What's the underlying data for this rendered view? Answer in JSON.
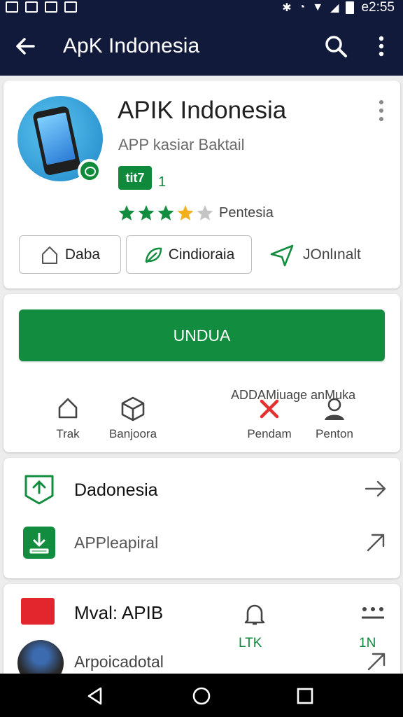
{
  "status_bar": {
    "time": "e2:55"
  },
  "app_bar": {
    "title": "ApK Indonesia"
  },
  "app": {
    "name": "APIK Indonesia",
    "developer": "APP kasiar Baktail",
    "rating_badge": "tit7",
    "rating_count": "1",
    "stars": 3.5,
    "rating_label": "Pentesia"
  },
  "chips": [
    {
      "label": "Daba",
      "icon": "home-icon"
    },
    {
      "label": "Cindioraia",
      "icon": "leaf-icon"
    }
  ],
  "share": {
    "label": "JOnlınalt",
    "icon": "send-icon"
  },
  "install": {
    "label": "UNDUA"
  },
  "ads_text": "ADDAMiuage anMuka",
  "actions": [
    {
      "label": "Trak",
      "icon": "home-icon"
    },
    {
      "label": "Banjoora",
      "icon": "box-icon"
    },
    {
      "label": "Pendam",
      "icon": "x-mark-icon"
    },
    {
      "label": "Penton",
      "icon": "person-icon"
    }
  ],
  "links": [
    {
      "title": "Dadonesia",
      "icon": "badge-icon"
    },
    {
      "title": "APPleapiral",
      "icon": "download-icon"
    }
  ],
  "related": {
    "title": "Mval: APIB",
    "bell_label": "LTK",
    "dots_label": "1N",
    "subtitle": "Arpoicadotal"
  },
  "colors": {
    "primary": "#128c3e",
    "appbar": "#121a3b",
    "star": "#f2b01e"
  }
}
